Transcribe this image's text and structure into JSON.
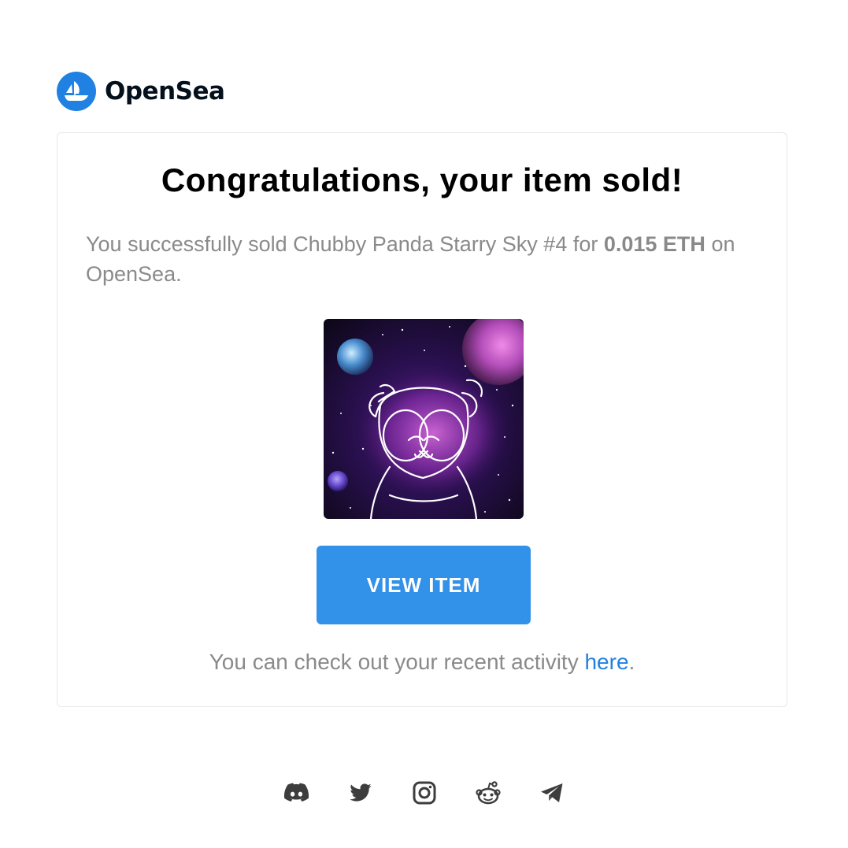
{
  "brand": {
    "name": "OpenSea",
    "logo_icon": "opensea-ship-icon",
    "color": "#2081e2"
  },
  "card": {
    "headline": "Congratulations, your item sold!",
    "message": {
      "prefix": "You successfully sold Chubby Panda Starry Sky #4 for ",
      "price": "0.015 ETH",
      "suffix": " on OpenSea."
    },
    "button_label": "VIEW ITEM",
    "button_color": "#3291e9",
    "activity": {
      "prefix": "You can check out your recent activity ",
      "link_text": "here",
      "suffix": "."
    }
  },
  "socials": [
    {
      "icon": "discord-icon"
    },
    {
      "icon": "twitter-icon"
    },
    {
      "icon": "instagram-icon"
    },
    {
      "icon": "reddit-icon"
    },
    {
      "icon": "telegram-icon"
    }
  ]
}
